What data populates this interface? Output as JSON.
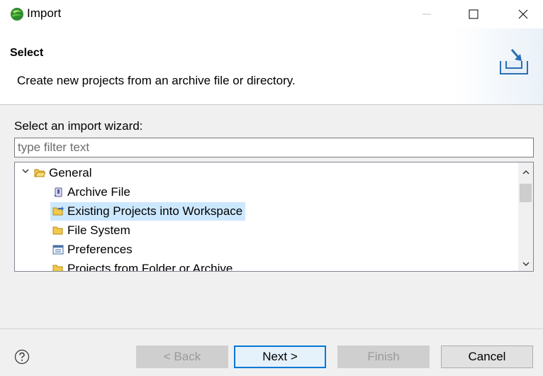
{
  "window": {
    "title": "Import",
    "icon": "eclipse-sphere-icon"
  },
  "header": {
    "title": "Select",
    "description": "Create new projects from an archive file or directory.",
    "image": "import-tray-icon"
  },
  "wizard": {
    "label": "Select an import wizard:",
    "filter_placeholder": "type filter text",
    "filter_value": ""
  },
  "tree": {
    "root": {
      "label": "General",
      "expanded": true,
      "icon": "open-folder-icon"
    },
    "items": [
      {
        "label": "Archive File",
        "icon": "archive-file-icon",
        "selected": false
      },
      {
        "label": "Existing Projects into Workspace",
        "icon": "project-folder-icon",
        "selected": true
      },
      {
        "label": "File System",
        "icon": "folder-icon",
        "selected": false
      },
      {
        "label": "Preferences",
        "icon": "preferences-icon",
        "selected": false
      },
      {
        "label": "Projects from Folder or Archive",
        "icon": "folder-icon",
        "selected": false
      }
    ]
  },
  "buttons": {
    "back": "< Back",
    "next": "Next >",
    "finish": "Finish",
    "cancel": "Cancel"
  },
  "colors": {
    "selection": "#cce8ff",
    "default_button_border": "#0078d7"
  }
}
